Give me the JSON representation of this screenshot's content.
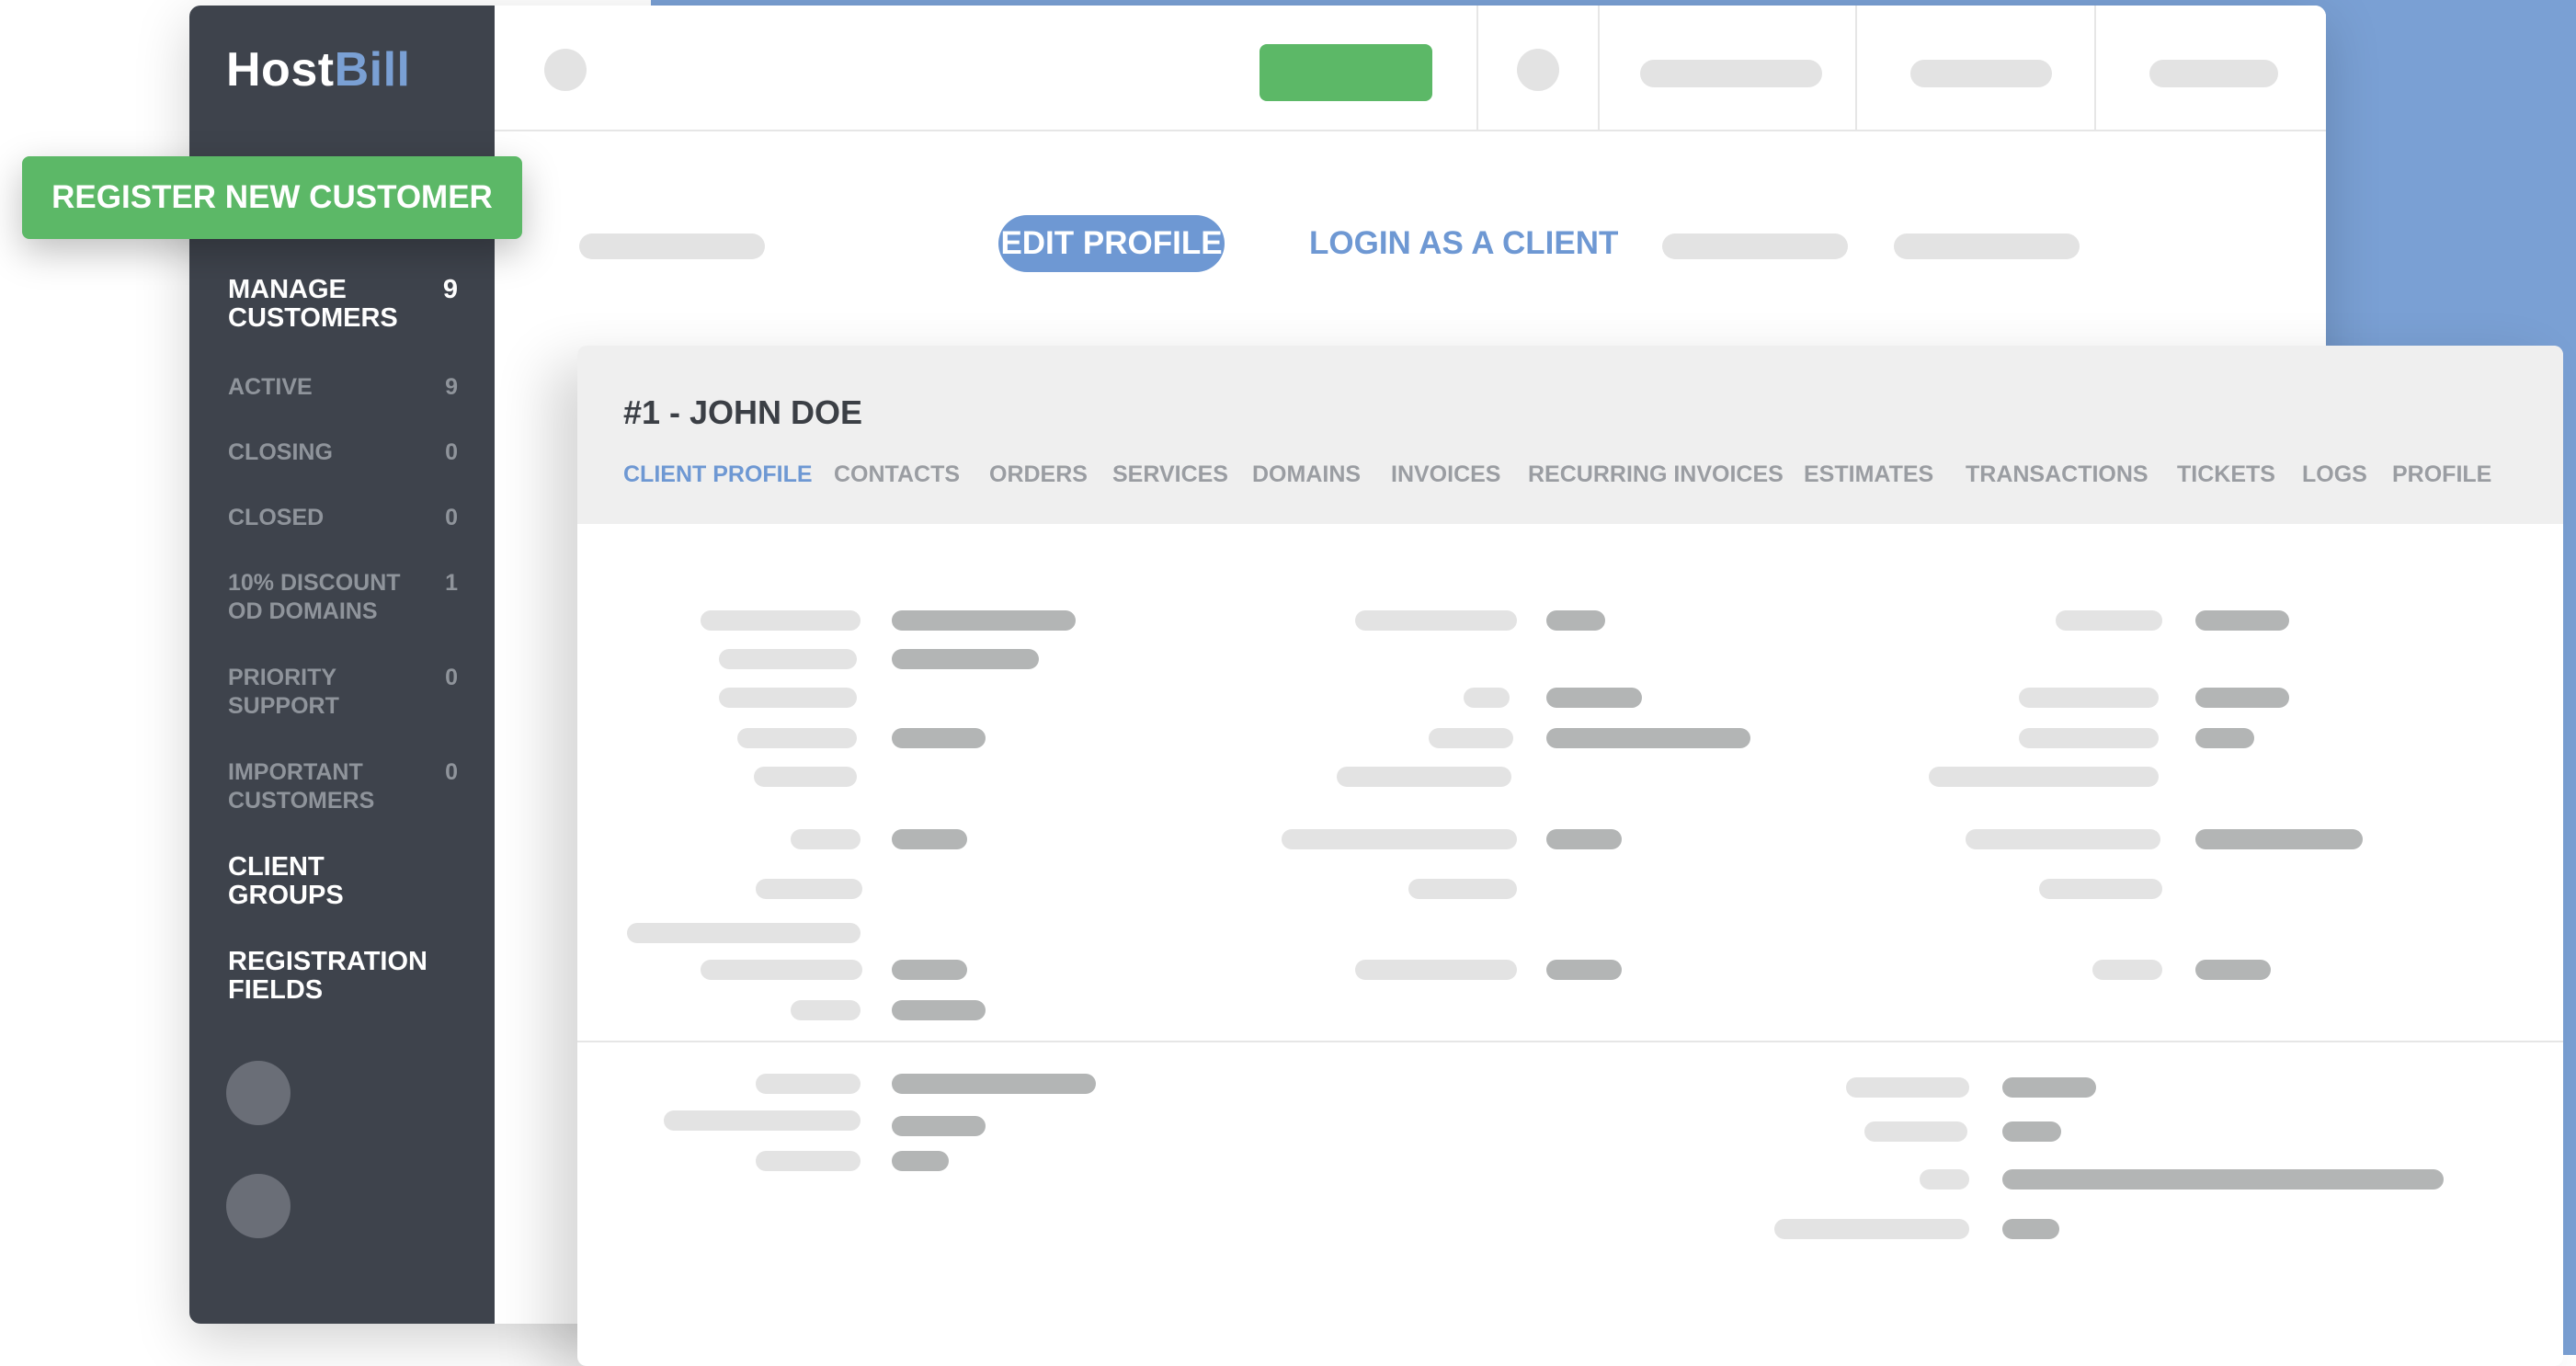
{
  "brand": {
    "host": "Host",
    "bill": "Bill"
  },
  "colors": {
    "accent_blue": "#6e98d3",
    "green": "#5cb867",
    "sidebar_bg": "#3e434c",
    "placeholder_light": "#e3e3e3",
    "placeholder_dark": "#b3b5b5"
  },
  "register_button": {
    "label": "REGISTER NEW CUSTOMER"
  },
  "sidebar": {
    "items": [
      {
        "label": "MANAGE CUSTOMERS",
        "count": "9"
      },
      {
        "label": "ACTIVE",
        "count": "9"
      },
      {
        "label": "CLOSING",
        "count": "0"
      },
      {
        "label": "CLOSED",
        "count": "0"
      },
      {
        "label": "10% DISCOUNT OD DOMAINS",
        "count": "1"
      },
      {
        "label": "PRIORITY SUPPORT",
        "count": "0"
      },
      {
        "label": "IMPORTANT CUSTOMERS",
        "count": "0"
      },
      {
        "label": "CLIENT GROUPS"
      },
      {
        "label": "REGISTRATION FIELDS"
      }
    ]
  },
  "actions": {
    "edit_profile": "EDIT PROFILE",
    "login_as_client": "LOGIN AS A CLIENT"
  },
  "client": {
    "title": "#1 - JOHN DOE",
    "tabs": [
      "CLIENT PROFILE",
      "CONTACTS",
      "ORDERS",
      "SERVICES",
      "DOMAINS",
      "INVOICES",
      "RECURRING INVOICES",
      "ESTIMATES",
      "TRANSACTIONS",
      "TICKETS",
      "LOGS",
      "PROFILE"
    ],
    "active_tab": "CLIENT PROFILE"
  }
}
